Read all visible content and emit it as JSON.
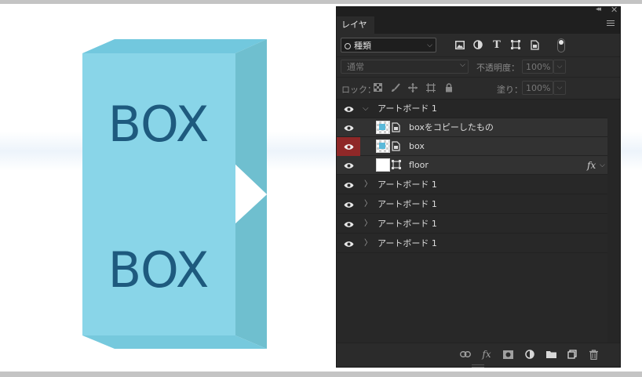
{
  "artwork": {
    "top_label": "BOX",
    "bottom_label": "BOX",
    "colors": {
      "front": "#89d5e8",
      "top": "#72c8de",
      "side": "#6fbfcf",
      "text": "#1e5a7e"
    }
  },
  "panel": {
    "tab_label": "レイヤー",
    "filter": {
      "kind_label": "種類",
      "icons": [
        "image-filter-icon",
        "adjustment-filter-icon",
        "type-filter-icon",
        "shape-filter-icon",
        "smart-object-filter-icon"
      ]
    },
    "blend": {
      "mode": "通常",
      "opacity_label": "不透明度：",
      "opacity_value": "100%"
    },
    "lock": {
      "label": "ロック：",
      "fill_label": "塗り：",
      "fill_value": "100%"
    },
    "layers": [
      {
        "name": "アートボード 1",
        "type": "artboard",
        "expanded": true,
        "visible": true
      },
      {
        "name": "boxをコピーしたもの",
        "type": "smart-object",
        "visible": true
      },
      {
        "name": "box",
        "type": "smart-object",
        "visible": true,
        "eye_highlighted": true
      },
      {
        "name": "floor",
        "type": "shape",
        "visible": true,
        "fx": "fx"
      },
      {
        "name": "アートボード 1",
        "type": "artboard",
        "expanded": false,
        "visible": true
      },
      {
        "name": "アートボード 1",
        "type": "artboard",
        "expanded": false,
        "visible": true
      },
      {
        "name": "アートボード 1",
        "type": "artboard",
        "expanded": false,
        "visible": true
      },
      {
        "name": "アートボード 1",
        "type": "artboard",
        "expanded": false,
        "visible": true
      }
    ],
    "bottom_icons": [
      "link-layers-icon",
      "fx-icon",
      "layer-mask-icon",
      "adjustment-layer-icon",
      "new-group-icon",
      "new-layer-icon",
      "delete-layer-icon"
    ],
    "accent_eye_color": "#8f2828"
  }
}
